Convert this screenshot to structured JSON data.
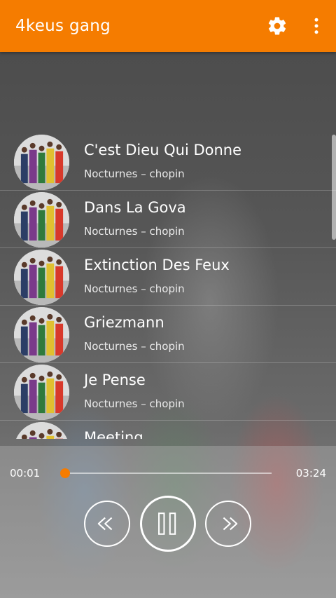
{
  "app": {
    "title": "4keus gang"
  },
  "toolbar": {
    "settings_icon": "gear-icon",
    "more_icon": "more-vert-icon"
  },
  "songs": [
    {
      "title": "C'est Dieu Qui Donne",
      "subtitle": "Nocturnes – chopin"
    },
    {
      "title": "Dans La Gova",
      "subtitle": "Nocturnes – chopin"
    },
    {
      "title": "Extinction Des Feux",
      "subtitle": "Nocturnes – chopin"
    },
    {
      "title": "Griezmann",
      "subtitle": "Nocturnes – chopin"
    },
    {
      "title": "Je Pense",
      "subtitle": "Nocturnes – chopin"
    },
    {
      "title": "Meeting",
      "subtitle": ""
    }
  ],
  "player": {
    "elapsed": "00:01",
    "duration": "03:24",
    "progress_fraction": 0.005,
    "accent": "#f57c00",
    "prev_icon": "rewind-icon",
    "pause_icon": "pause-icon",
    "next_icon": "fast-forward-icon"
  }
}
